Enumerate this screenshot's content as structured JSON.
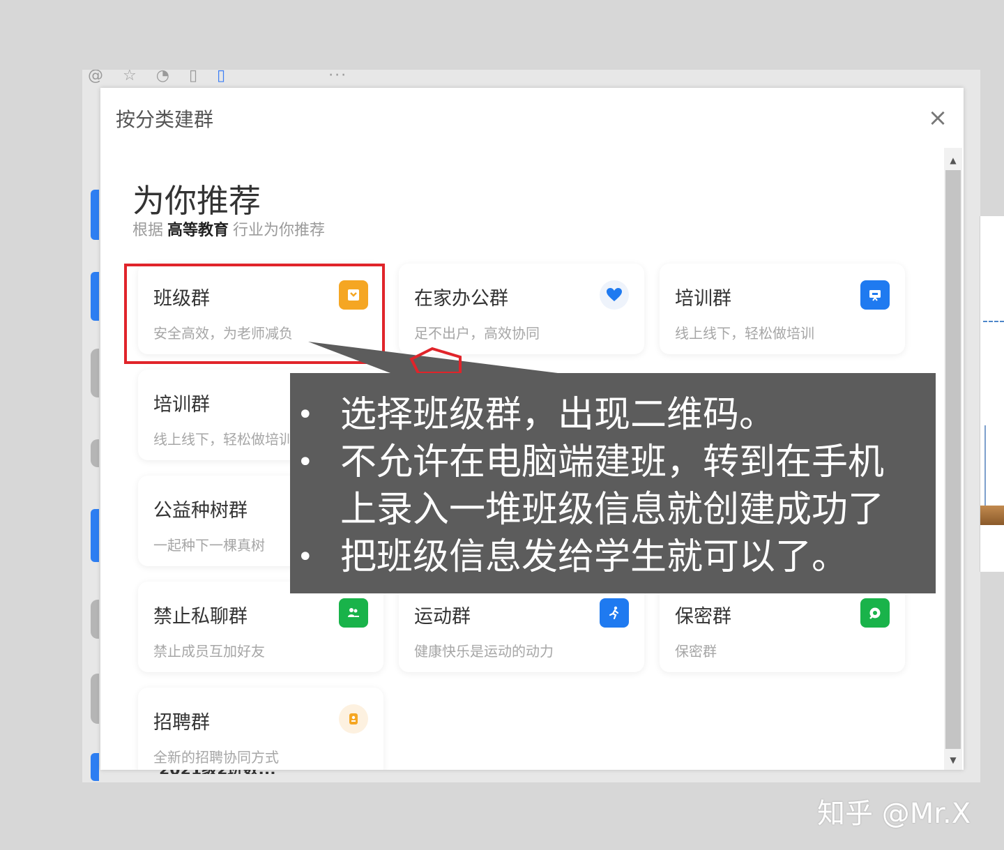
{
  "toolbar": {
    "icons": [
      "at-icon",
      "star-icon",
      "history-icon",
      "file-icon",
      "phone-icon",
      "more-icon"
    ],
    "more_label": "···"
  },
  "background": {
    "bottom_text": "2021级2班数..."
  },
  "modal": {
    "title": "按分类建群",
    "close_label": "×",
    "recommend": {
      "heading": "为你推荐",
      "sub_prefix": "根据",
      "sub_industry": "高等教育",
      "sub_suffix": "行业为你推荐"
    },
    "cards": [
      {
        "title": "班级群",
        "desc": "安全高效，为老师减负",
        "icon": "class-group-icon",
        "color": "#f5a623"
      },
      {
        "title": "在家办公群",
        "desc": "足不出户，高效协同",
        "icon": "heart-icon",
        "color": "#1f7af0"
      },
      {
        "title": "培训群",
        "desc": "线上线下，轻松做培训",
        "icon": "training-board-icon",
        "color": "#1f7af0"
      },
      {
        "title": "培训群",
        "desc": "线上线下，轻松做培训"
      },
      {
        "title": "公益种树群",
        "desc": "一起种下一棵真树"
      },
      {
        "title": "禁止私聊群",
        "desc": "禁止成员互加好友",
        "icon": "no-chat-icon",
        "color": "#19b34a"
      },
      {
        "title": "运动群",
        "desc": "健康快乐是运动的动力",
        "icon": "runner-icon",
        "color": "#1f7af0"
      },
      {
        "title": "保密群",
        "desc": "保密群",
        "icon": "secret-chat-icon",
        "color": "#19b34a"
      },
      {
        "title": "招聘群",
        "desc": "全新的招聘协同方式",
        "icon": "recruit-icon",
        "color": "#f5a623"
      }
    ]
  },
  "callout": {
    "lines": [
      {
        "bullet": "•",
        "text": "选择班级群，出现二维码。"
      },
      {
        "bullet": "•",
        "text": "不允许在电脑端建班，转到在手机"
      },
      {
        "bullet": "",
        "text": "上录入一堆班级信息就创建成功了"
      },
      {
        "bullet": "•",
        "text": "把班级信息发给学生就可以了。"
      }
    ]
  },
  "watermark": "知乎 @Mr.X"
}
